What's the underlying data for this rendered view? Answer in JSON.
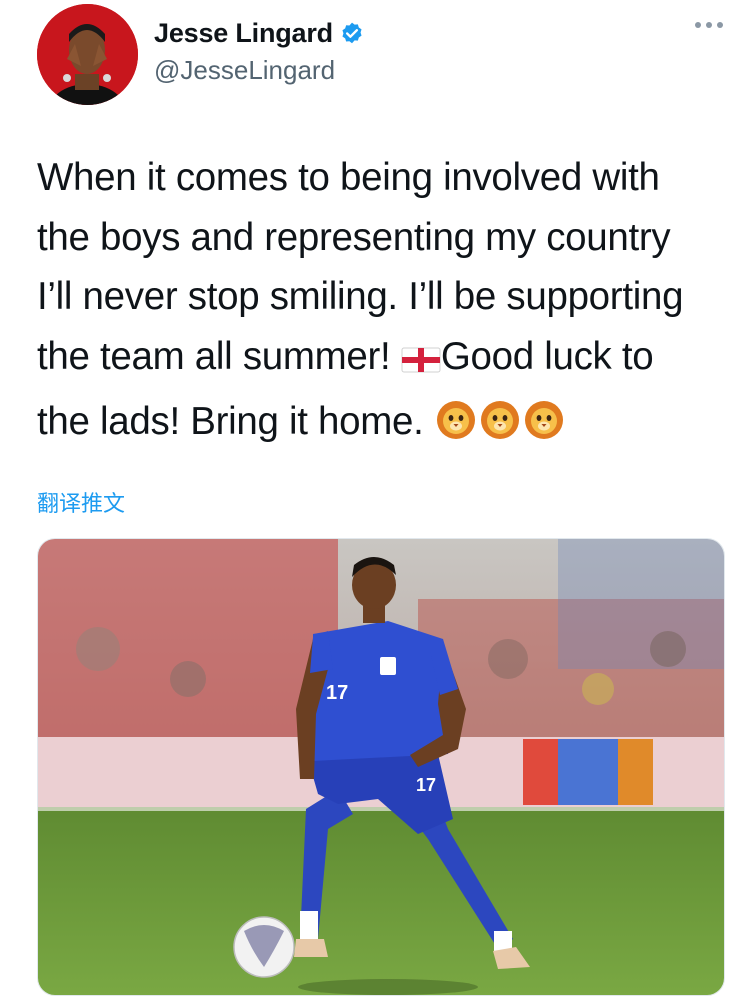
{
  "author": {
    "name": "Jesse Lingard",
    "handle": "@JesseLingard",
    "verified": true,
    "avatar_icon": "profile-photo"
  },
  "tweet": {
    "lines": [
      "When it comes to being involved with",
      "the boys and representing my country",
      "I’ll never stop smiling. I’ll be supporting",
      "the team all summer! ",
      "the lads! Bring it home. "
    ],
    "line4_after_flag": "Good luck to",
    "flag_emoji": "england-flag-icon",
    "lion_emojis": [
      "lion-face-icon",
      "lion-face-icon",
      "lion-face-icon"
    ]
  },
  "translate_label": "翻译推文",
  "media": {
    "jersey_number": "17"
  },
  "colors": {
    "link_blue": "#1d9bf0",
    "verified_blue": "#1d9bf0",
    "kit_blue": "#2f4fd1",
    "pitch_green": "#6f9a3a"
  }
}
